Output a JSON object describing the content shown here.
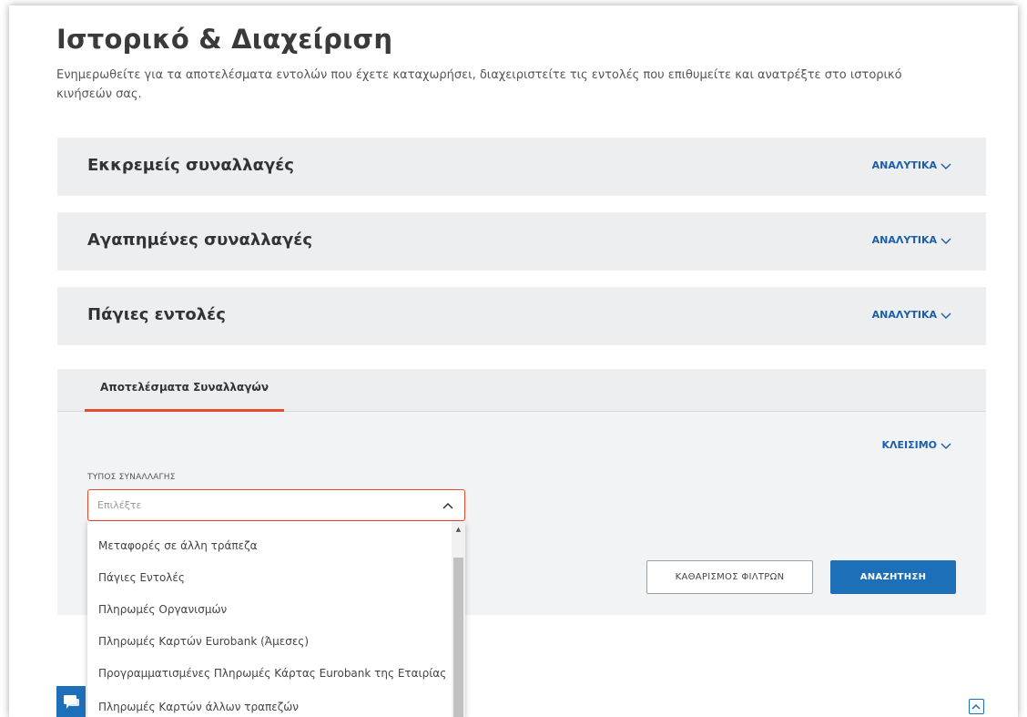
{
  "page": {
    "title": "Ιστορικό & Διαχείριση",
    "description": "Ενημερωθείτε για τα αποτελέσματα εντολών που έχετε καταχωρήσει, διαχειριστείτε τις εντολές που επιθυμείτε και ανατρέξτε στο ιστορικό κινήσεών σας."
  },
  "accordions": [
    {
      "title": "Εκκρεμείς συναλλαγές",
      "link": "ΑΝΑΛΥΤΙΚΑ"
    },
    {
      "title": "Αγαπημένες συναλλαγές",
      "link": "ΑΝΑΛΥΤΙΚΑ"
    },
    {
      "title": "Πάγιες εντολές",
      "link": "ΑΝΑΛΥΤΙΚΑ"
    }
  ],
  "results": {
    "tab_label": "Αποτελέσματα Συναλλαγών",
    "close_label": "ΚΛΕΙΣΙΜΟ",
    "field_label": "ΤΥΠΟΣ ΣΥΝΑΛΛΑΓΗΣ",
    "select_placeholder": "Επιλέξτε",
    "clear_button": "ΚΑΘΑΡΙΣΜΟΣ ΦΙΛΤΡΩΝ",
    "search_button": "ΑΝΑΖΗΤΗΣΗ"
  },
  "dropdown": {
    "options": [
      "Μεταφορές σε άλλη τράπεζα",
      "Πάγιες Εντολές",
      "Πληρωμές Οργανισμών",
      "Πληρωμές Καρτών Eurobank (Άμεσες)",
      "Προγραμματισμένες Πληρωμές Κάρτας Eurobank της Εταιρίας",
      "Πληρωμές Καρτών άλλων τραπεζών"
    ]
  },
  "icons": {
    "accordion_chevron": "chevron-down-icon",
    "select_caret": "chevron-up-icon",
    "chat": "chat-icon",
    "scroll_top": "arrow-up-icon"
  },
  "colors": {
    "accent_red": "#e34b2b",
    "link_blue": "#1b5eab",
    "primary_blue": "#1d6fb8",
    "panel_gray": "#eceeef"
  }
}
